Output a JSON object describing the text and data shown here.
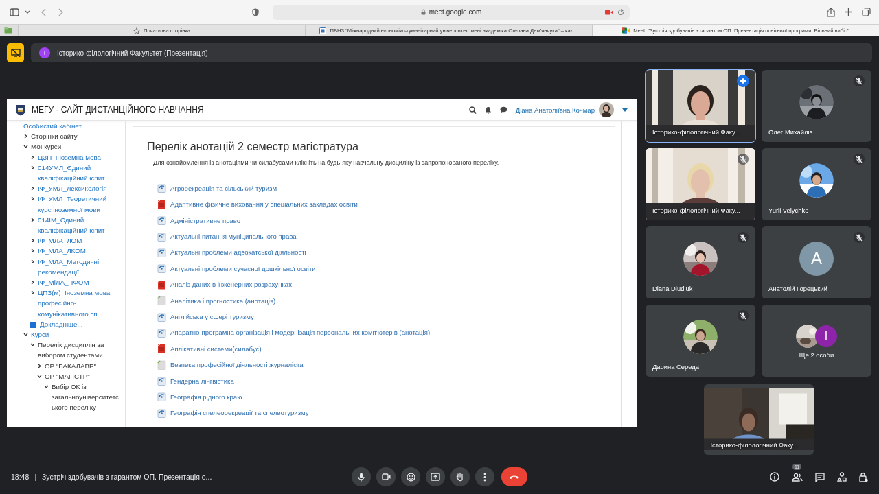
{
  "browser": {
    "address": "meet.google.com",
    "tabs": [
      {
        "label": "Початкова сторінка",
        "kind": "start",
        "selected": false
      },
      {
        "label": "ПВНЗ \"Міжнародний економіко-гуманітарний університет імені академіка Степана Дем'янчука\" – кал...",
        "kind": "site",
        "selected": false
      },
      {
        "label": "Meet: \"Зустріч здобувачів з гарантом ОП. Презентація освітньої програми. Вільний вибір\"",
        "kind": "meet",
        "selected": true
      }
    ]
  },
  "presentation_banner": {
    "initial": "I",
    "title": "Історико-філологічний Факультет (Презентація)"
  },
  "shared_screen": {
    "site_title": "МЕГУ - САЙТ ДИСТАНЦІЙНОГО НАВЧАННЯ",
    "user_name": "Діана Анатоліївна Кочмар",
    "sidebar": {
      "items": [
        {
          "label": "Особистий кабінет",
          "kind": "link"
        },
        {
          "label": "Сторінки сайту",
          "kind": "section",
          "expanded": false
        },
        {
          "label": "Мої курси",
          "kind": "section",
          "expanded": true,
          "children": [
            {
              "label": "ЦЗП_Іноземна мова",
              "kind": "link",
              "expanded": false
            },
            {
              "label": "014УМЛ_Єдиний кваліфікаційний іспит",
              "kind": "link",
              "expanded": false
            },
            {
              "label": "ІФ_УМЛ_Лексикологія",
              "kind": "link",
              "expanded": false
            },
            {
              "label": "ІФ_УМЛ_Теоретичний курс іноземної мови",
              "kind": "link",
              "expanded": false
            },
            {
              "label": "014ІМ_Єдиний кваліфікаційний іспит",
              "kind": "link",
              "expanded": false
            },
            {
              "label": "ІФ_МЛА_ЛОМ",
              "kind": "link",
              "expanded": false
            },
            {
              "label": "ІФ_МЛА_ЛКОМ",
              "kind": "link",
              "expanded": false
            },
            {
              "label": "ІФ_МЛА_Методичні рекомендації",
              "kind": "link",
              "expanded": false
            },
            {
              "label": "ІФ_МіЛА_ПФОМ",
              "kind": "link",
              "expanded": false
            },
            {
              "label": "ЦПЗ(м)_Іноземна мова професійно-комунікативного сп...",
              "kind": "link",
              "expanded": false
            },
            {
              "label": "Докладніше...",
              "kind": "more"
            }
          ]
        },
        {
          "label": "Курси",
          "kind": "link",
          "expanded": true,
          "children": [
            {
              "label": "Перелік дисциплін за вибором студентами",
              "kind": "section",
              "expanded": true,
              "children": [
                {
                  "label": "ОР \"БАКАЛАВР\"",
                  "kind": "section",
                  "expanded": false
                },
                {
                  "label": "ОР \"МАГІСТР\"",
                  "kind": "section",
                  "expanded": true,
                  "children": [
                    {
                      "label": "Вибір ОК із загальноуніверситетського переліку",
                      "kind": "section",
                      "expanded": true
                    }
                  ]
                }
              ]
            }
          ]
        }
      ]
    },
    "heading": "Перелік анотацій 2 семестр магістратура",
    "intro": "Для ознайомлення із анотаціями чи силабусами клікніть на будь-яку навчальну дисциліну із запропонованого переліку.",
    "resources": [
      {
        "label": "Агрорекреація та сільський туризм",
        "kind": "page"
      },
      {
        "label": "Адаптивне фізичне виховання у спеціальних закладах освіти",
        "kind": "pdf"
      },
      {
        "label": "Адміністративне право",
        "kind": "page"
      },
      {
        "label": "Актуальні питання муніципального права",
        "kind": "page"
      },
      {
        "label": "Актуальні проблеми адвокатської діяльності",
        "kind": "page"
      },
      {
        "label": "Актуальні проблеми сучасної дошкільної освіти",
        "kind": "page"
      },
      {
        "label": "Аналіз даних в інженерних розрахунках",
        "kind": "pdf"
      },
      {
        "label": "Аналітика і прогностика (анотація)",
        "kind": "file"
      },
      {
        "label": "Англійська у сфері туризму",
        "kind": "page"
      },
      {
        "label": "Апаратно-програмна організація і модернізація персональних комп'ютерів (анотація)",
        "kind": "page"
      },
      {
        "label": "Аплікативні системи(силабус)",
        "kind": "pdf"
      },
      {
        "label": "Безпека професійної діяльності журналіста",
        "kind": "file"
      },
      {
        "label": "Гендерна лінгвістика",
        "kind": "page"
      },
      {
        "label": "Географія рідного краю",
        "kind": "page"
      },
      {
        "label": "Географія спелеорекреації та спелеотуризму",
        "kind": "page"
      }
    ]
  },
  "participants": [
    {
      "name": "Історико-філологічний Факу...",
      "kind": "video",
      "muted": false,
      "speaking": true
    },
    {
      "name": "Олег Михайлів",
      "muted": true,
      "speaking": false
    },
    {
      "name": "Історико-філологічний Факу...",
      "kind": "video",
      "muted": true,
      "speaking": false
    },
    {
      "name": "Yurii Velychko",
      "muted": true,
      "speaking": false
    },
    {
      "name": "Diana Diudiuk",
      "muted": true,
      "speaking": false
    },
    {
      "name": "Анатолій Горецький",
      "kind": "letter",
      "initial": "А",
      "color": "#7f97a6",
      "muted": true,
      "speaking": false
    },
    {
      "name": "Дарина Середа",
      "muted": true,
      "speaking": false
    },
    {
      "name": "Ще 2 особи",
      "kind": "more",
      "initial": "I",
      "color": "#8e24aa",
      "muted": false,
      "speaking": false
    }
  ],
  "self_view": {
    "name": "Історико-філологічний Факу..."
  },
  "bottom_bar": {
    "time": "18:48",
    "separator": "|",
    "meeting_title": "Зустріч здобувачів з гарантом ОП. Презентація о...",
    "people_count": "11"
  }
}
